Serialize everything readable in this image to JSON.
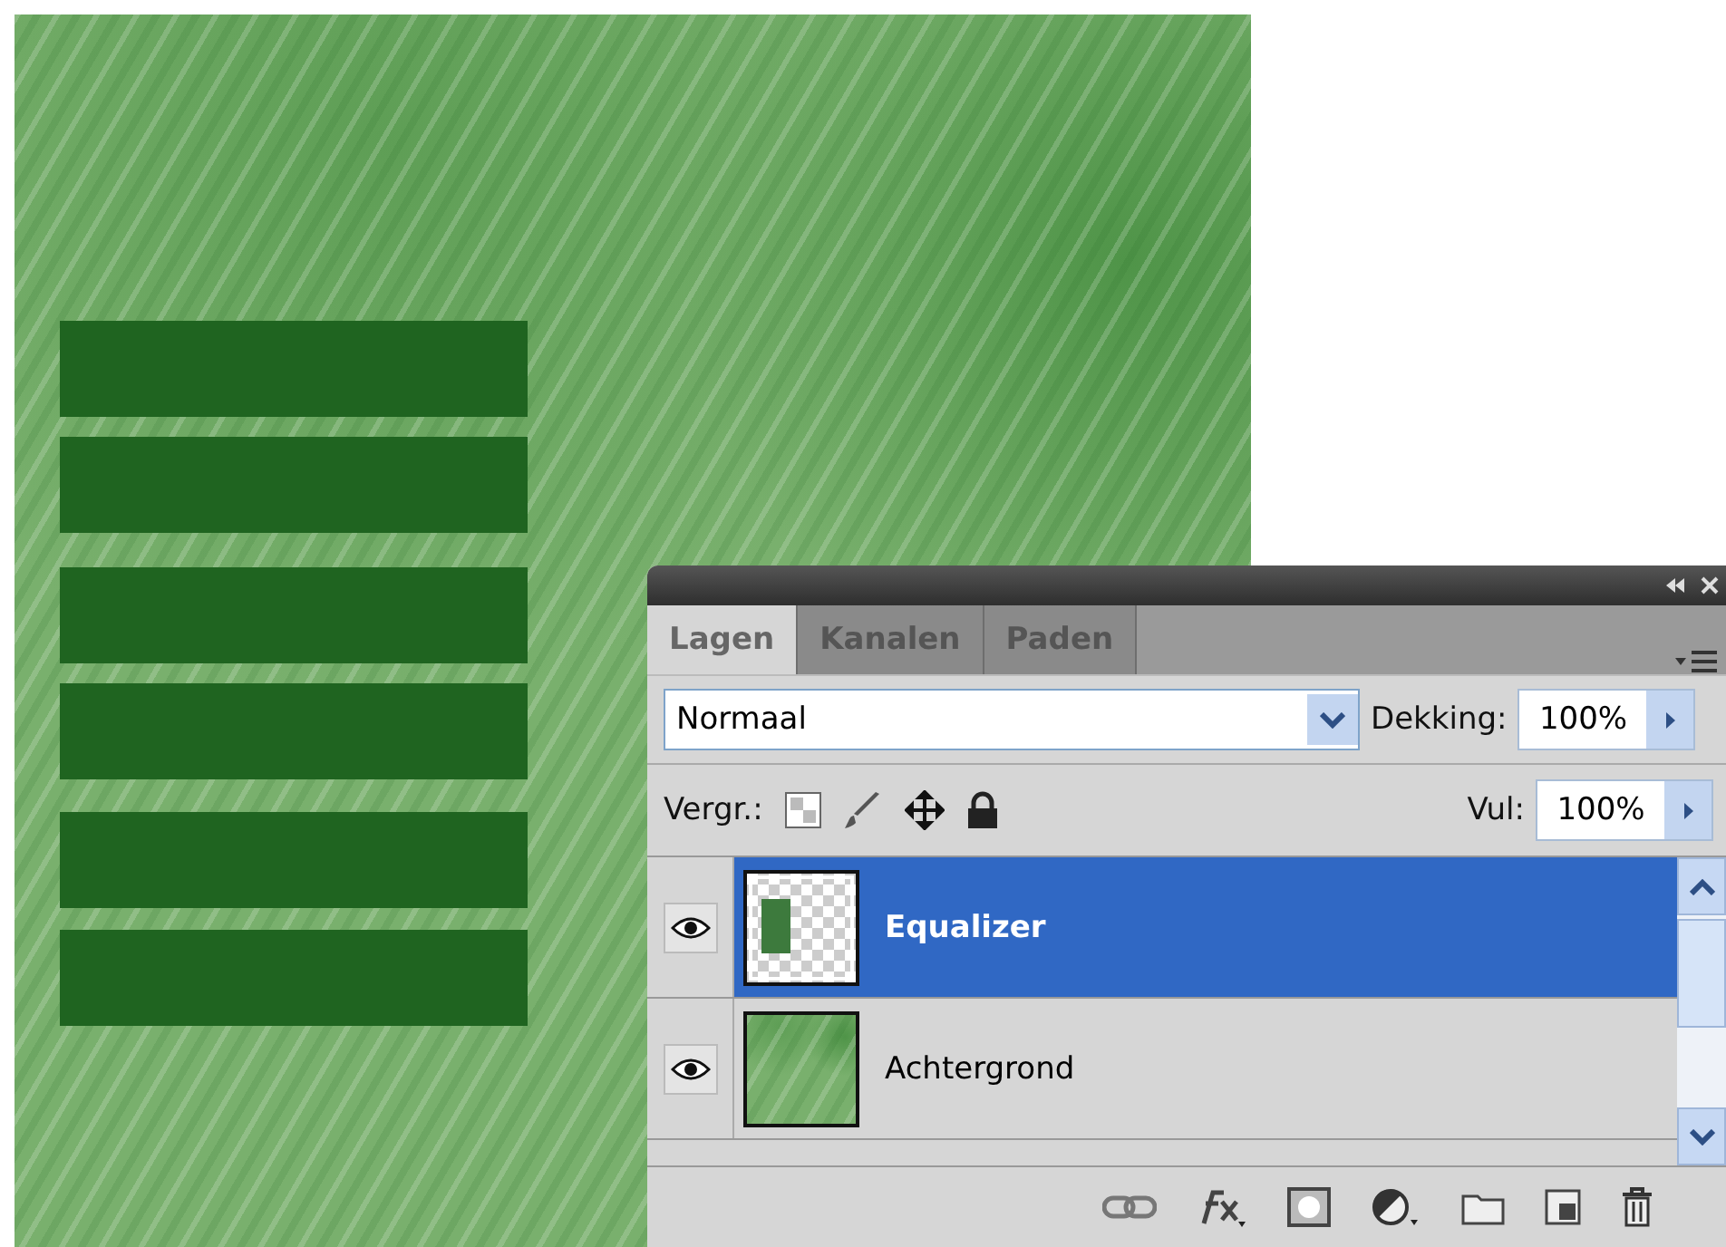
{
  "panel": {
    "tabs": [
      {
        "label": "Lagen",
        "selected": true
      },
      {
        "label": "Kanalen",
        "selected": false
      },
      {
        "label": "Paden",
        "selected": false
      }
    ],
    "blend_mode": "Normaal",
    "opacity_label": "Dekking:",
    "opacity": "100%",
    "lock_label": "Vergr.:",
    "fill_label": "Vul:",
    "fill": "100%",
    "layers": [
      {
        "name": "Equalizer",
        "selected": true,
        "visible": true,
        "kind": "transparent"
      },
      {
        "name": "Achtergrond",
        "selected": false,
        "visible": true,
        "kind": "texture"
      }
    ]
  }
}
